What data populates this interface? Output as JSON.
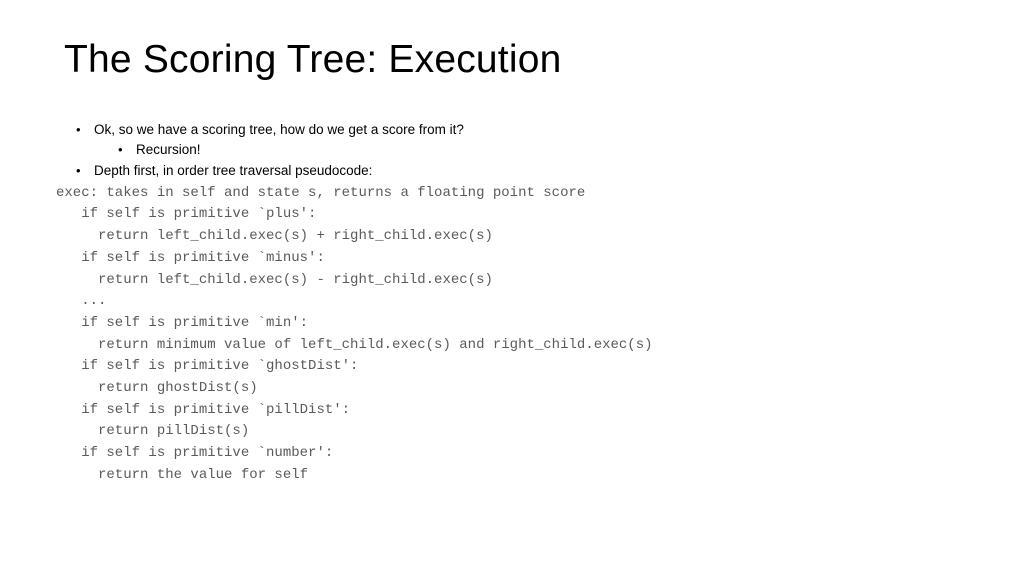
{
  "title": "The Scoring Tree: Execution",
  "bullets": {
    "b1": "Ok, so we have a scoring tree, how do we get a score from it?",
    "b1_sub": "Recursion!",
    "b2": "Depth first, in order tree traversal pseudocode:"
  },
  "code": {
    "l0": "exec: takes in self and state s, returns a floating point score",
    "l1": "   if self is primitive `plus':",
    "l2": "     return left_child.exec(s) + right_child.exec(s)",
    "l3": "   if self is primitive `minus':",
    "l4": "     return left_child.exec(s) - right_child.exec(s)",
    "l5": "   ...",
    "l6": "   if self is primitive `min':",
    "l7": "     return minimum value of left_child.exec(s) and right_child.exec(s)",
    "l8": "   if self is primitive `ghostDist':",
    "l9": "     return ghostDist(s)",
    "l10": "   if self is primitive `pillDist':",
    "l11": "     return pillDist(s)",
    "l12": "   if self is primitive `number':",
    "l13": "     return the value for self"
  }
}
